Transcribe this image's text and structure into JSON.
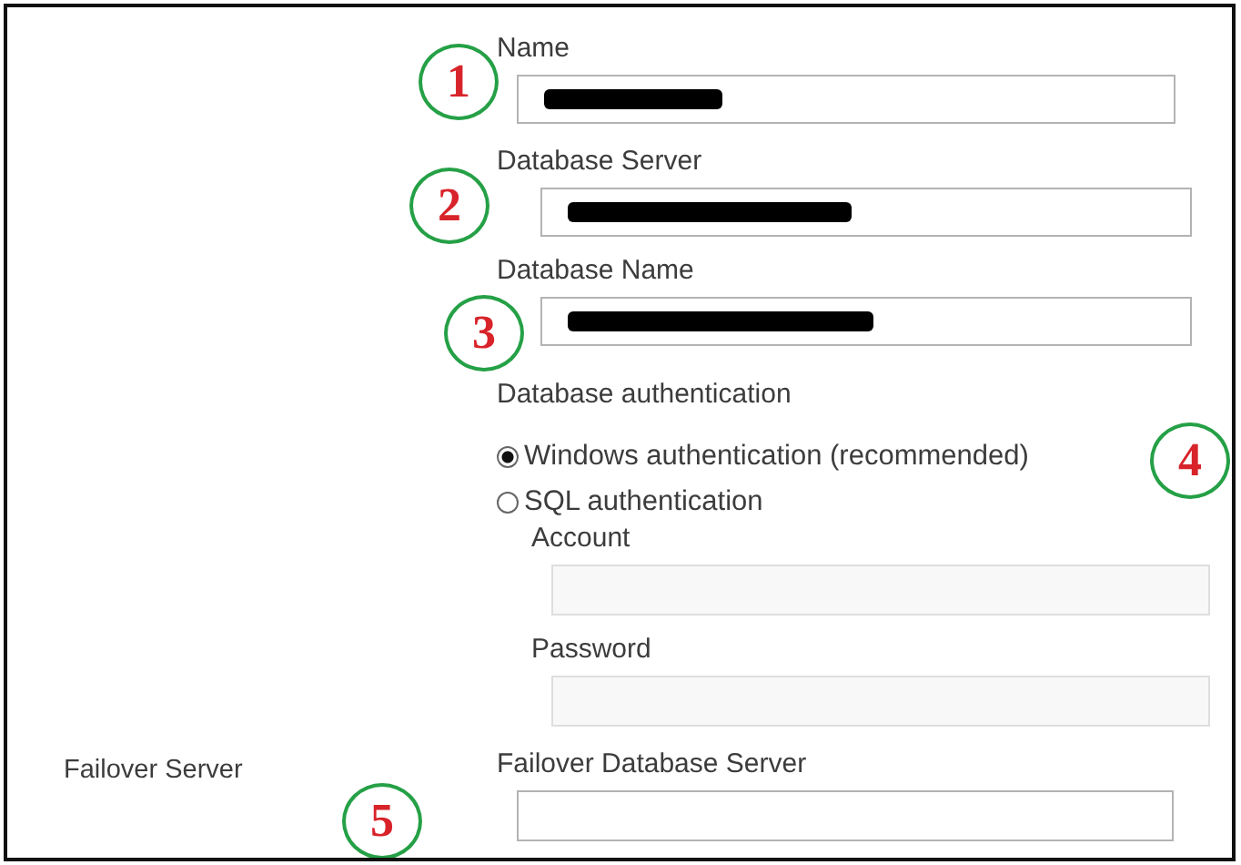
{
  "fields": [
    {
      "label": "Name",
      "redacted": true
    },
    {
      "label": "Database Server",
      "redacted": true
    },
    {
      "label": "Database Name",
      "redacted": true
    }
  ],
  "authentication": {
    "label": "Database authentication",
    "options": [
      {
        "label": "Windows authentication (recommended)",
        "selected": true
      },
      {
        "label": "SQL authentication",
        "selected": false
      }
    ],
    "credentials": [
      {
        "label": "Account",
        "disabled": true
      },
      {
        "label": "Password",
        "disabled": true
      }
    ]
  },
  "failover": {
    "section_label": "Failover Server",
    "field_label": "Failover Database Server"
  },
  "annotations": [
    {
      "label": "1"
    },
    {
      "label": "2"
    },
    {
      "label": "3"
    },
    {
      "label": "4"
    },
    {
      "label": "5"
    }
  ]
}
